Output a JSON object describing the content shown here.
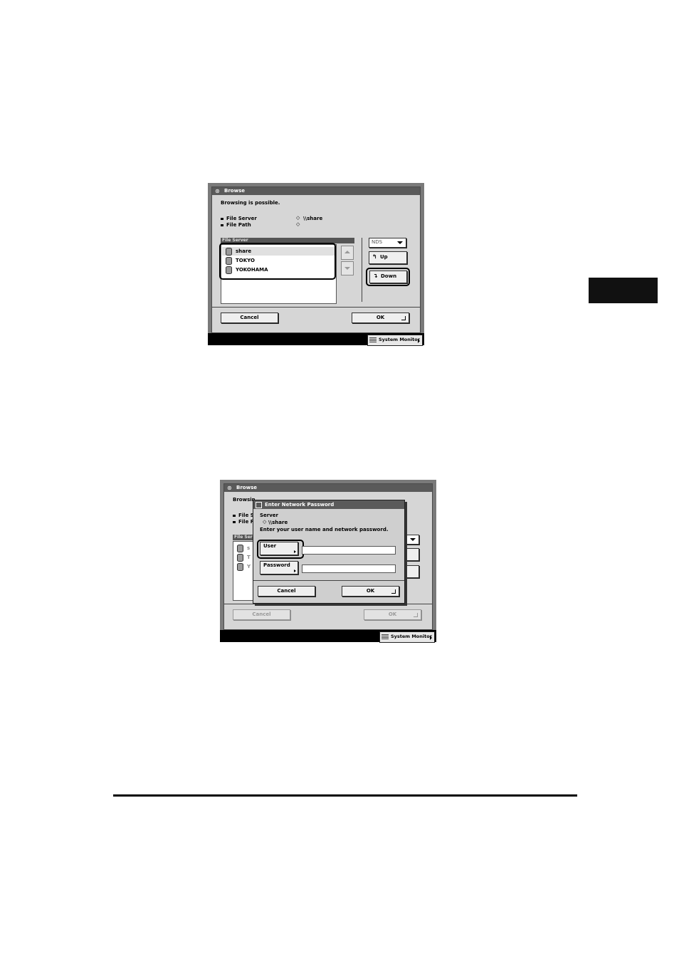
{
  "screen1": {
    "title": "Browse",
    "message": "Browsing is possible.",
    "file_server_label": "File Server",
    "file_server_value": "\\\\share",
    "file_path_label": "File Path",
    "file_path_value": "",
    "list_header": "File Server",
    "list_items": [
      "share",
      "TOKYO",
      "YOKOHAMA"
    ],
    "protocol_value": "NDS",
    "up_label": "Up",
    "down_label": "Down",
    "cancel_label": "Cancel",
    "ok_label": "OK",
    "system_monitor_label": "System Monitor"
  },
  "screen2": {
    "title": "Browse",
    "background_partial_1": "Browsin",
    "background_partial_2": "File S",
    "background_partial_3": "File F",
    "background_list_header": "File Ser",
    "background_item_initials": [
      "s",
      "T",
      "Y"
    ],
    "background_cancel_label": "Cancel",
    "background_ok_label": "OK",
    "system_monitor_label": "System Monitor",
    "dialog": {
      "title": "Enter Network Password",
      "server_label": "Server",
      "server_value": "\\\\share",
      "instruction": "Enter your user name and network password.",
      "user_label": "User",
      "user_value": "",
      "password_label": "Password",
      "password_value": "",
      "cancel_label": "Cancel",
      "ok_label": "OK"
    }
  }
}
